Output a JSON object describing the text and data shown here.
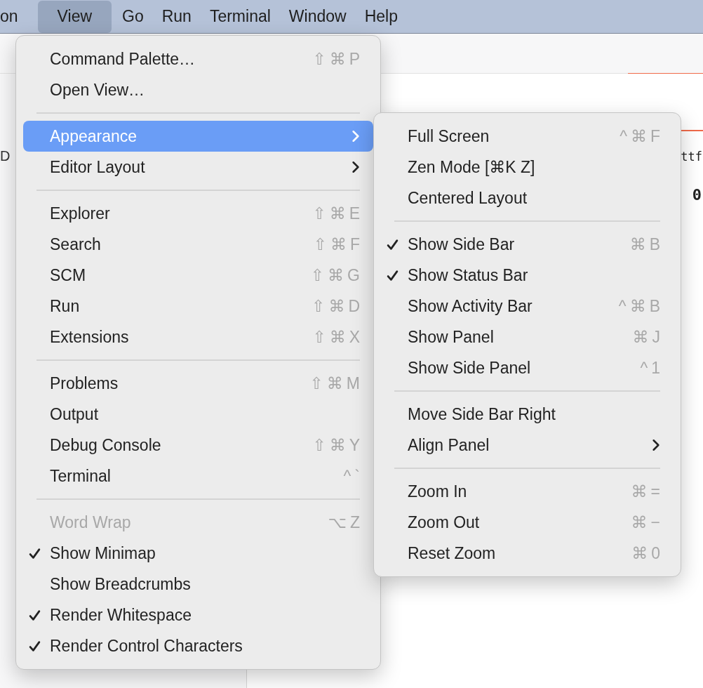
{
  "menu_bar": [
    {
      "label": "on",
      "selected": false
    },
    {
      "label": "View",
      "selected": true
    },
    {
      "label": "Go",
      "selected": false
    },
    {
      "label": "Run",
      "selected": false
    },
    {
      "label": "Terminal",
      "selected": false
    },
    {
      "label": "Window",
      "selected": false
    },
    {
      "label": "Help",
      "selected": false
    }
  ],
  "editor_fragments": [
    {
      "text": "D",
      "kind": "sidebar"
    },
    {
      "text": "ttf",
      "kind": "code"
    },
    {
      "text": "0",
      "kind": "bold-code"
    }
  ],
  "view_menu": [
    {
      "kind": "item",
      "label": "Command Palette…",
      "shortcut": "⇧⌘P",
      "checked": false,
      "disabled": false,
      "selected": false
    },
    {
      "kind": "item",
      "label": "Open View…",
      "checked": false,
      "disabled": false,
      "selected": false
    },
    {
      "kind": "separator"
    },
    {
      "kind": "submenu",
      "label": "Appearance",
      "checked": false,
      "disabled": false,
      "selected": true
    },
    {
      "kind": "submenu",
      "label": "Editor Layout",
      "checked": false,
      "disabled": false,
      "selected": false
    },
    {
      "kind": "separator"
    },
    {
      "kind": "item",
      "label": "Explorer",
      "shortcut": "⇧⌘E",
      "checked": false,
      "disabled": false,
      "selected": false
    },
    {
      "kind": "item",
      "label": "Search",
      "shortcut": "⇧⌘F",
      "checked": false,
      "disabled": false,
      "selected": false
    },
    {
      "kind": "item",
      "label": "SCM",
      "shortcut": "⇧⌘G",
      "checked": false,
      "disabled": false,
      "selected": false
    },
    {
      "kind": "item",
      "label": "Run",
      "shortcut": "⇧⌘D",
      "checked": false,
      "disabled": false,
      "selected": false
    },
    {
      "kind": "item",
      "label": "Extensions",
      "shortcut": "⇧⌘X",
      "checked": false,
      "disabled": false,
      "selected": false
    },
    {
      "kind": "separator"
    },
    {
      "kind": "item",
      "label": "Problems",
      "shortcut": "⇧⌘M",
      "checked": false,
      "disabled": false,
      "selected": false
    },
    {
      "kind": "item",
      "label": "Output",
      "checked": false,
      "disabled": false,
      "selected": false
    },
    {
      "kind": "item",
      "label": "Debug Console",
      "shortcut": "⇧⌘Y",
      "checked": false,
      "disabled": false,
      "selected": false
    },
    {
      "kind": "item",
      "label": "Terminal",
      "shortcut": "^`",
      "checked": false,
      "disabled": false,
      "selected": false
    },
    {
      "kind": "separator"
    },
    {
      "kind": "item",
      "label": "Word Wrap",
      "shortcut": "⌥Z",
      "checked": false,
      "disabled": true,
      "selected": false
    },
    {
      "kind": "item",
      "label": "Show Minimap",
      "checked": true,
      "disabled": false,
      "selected": false
    },
    {
      "kind": "item",
      "label": "Show Breadcrumbs",
      "checked": false,
      "disabled": false,
      "selected": false
    },
    {
      "kind": "item",
      "label": "Render Whitespace",
      "checked": true,
      "disabled": false,
      "selected": false
    },
    {
      "kind": "item",
      "label": "Render Control Characters",
      "checked": true,
      "disabled": false,
      "selected": false
    }
  ],
  "appearance_submenu": [
    {
      "kind": "item",
      "label": "Full Screen",
      "shortcut": "^⌘F",
      "checked": false,
      "disabled": false,
      "selected": false
    },
    {
      "kind": "item",
      "label": "Zen Mode [⌘K Z]",
      "checked": false,
      "disabled": false,
      "selected": false
    },
    {
      "kind": "item",
      "label": "Centered Layout",
      "checked": false,
      "disabled": false,
      "selected": false
    },
    {
      "kind": "separator"
    },
    {
      "kind": "item",
      "label": "Show Side Bar",
      "shortcut": "⌘B",
      "checked": true,
      "disabled": false,
      "selected": false
    },
    {
      "kind": "item",
      "label": "Show Status Bar",
      "checked": true,
      "disabled": false,
      "selected": false
    },
    {
      "kind": "item",
      "label": "Show Activity Bar",
      "shortcut": "^⌘B",
      "checked": false,
      "disabled": false,
      "selected": false
    },
    {
      "kind": "item",
      "label": "Show Panel",
      "shortcut": "⌘J",
      "checked": false,
      "disabled": false,
      "selected": false
    },
    {
      "kind": "item",
      "label": "Show Side Panel",
      "shortcut": "^1",
      "checked": false,
      "disabled": false,
      "selected": false
    },
    {
      "kind": "separator"
    },
    {
      "kind": "item",
      "label": "Move Side Bar Right",
      "checked": false,
      "disabled": false,
      "selected": false
    },
    {
      "kind": "submenu",
      "label": "Align Panel",
      "checked": false,
      "disabled": false,
      "selected": false
    },
    {
      "kind": "separator"
    },
    {
      "kind": "item",
      "label": "Zoom In",
      "shortcut": "⌘=",
      "checked": false,
      "disabled": false,
      "selected": false
    },
    {
      "kind": "item",
      "label": "Zoom Out",
      "shortcut": "⌘−",
      "checked": false,
      "disabled": false,
      "selected": false
    },
    {
      "kind": "item",
      "label": "Reset Zoom",
      "shortcut": "⌘0",
      "checked": false,
      "disabled": false,
      "selected": false
    }
  ]
}
